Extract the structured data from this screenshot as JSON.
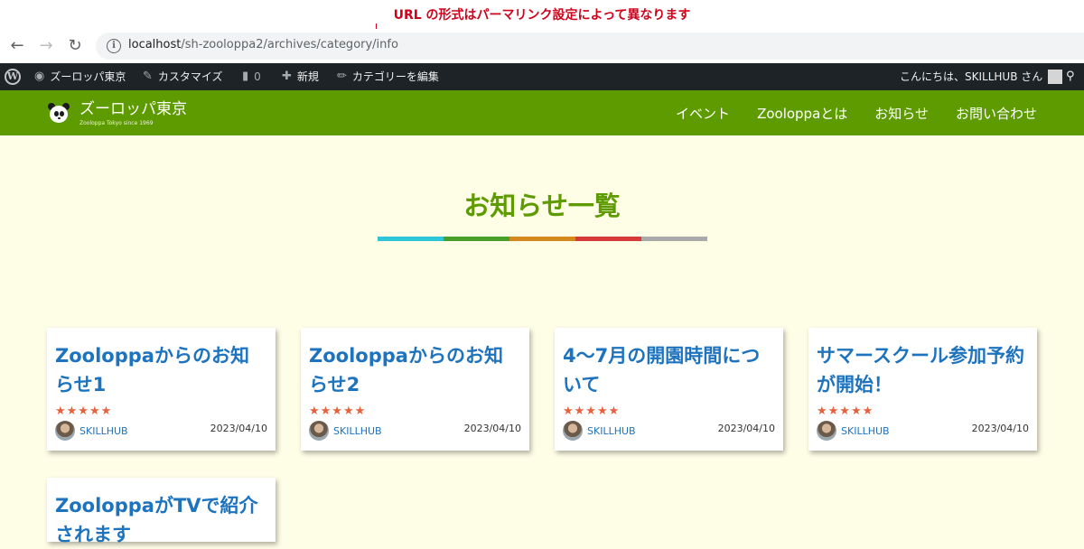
{
  "annotation": {
    "note": "URL の形式はパーマリンク設定によって異なります"
  },
  "browser": {
    "back_icon": "arrow-left-icon",
    "forward_icon": "arrow-right-icon",
    "reload_icon": "reload-icon",
    "url_host": "localhost",
    "url_path": "/sh-zooloppa2/archives/category/info"
  },
  "admin_bar": {
    "site_name": "ズーロッパ東京",
    "customize": "カスタマイズ",
    "comments_count": "0",
    "new": "新規",
    "edit_category": "カテゴリーを編集",
    "greeting": "こんにちは、SKILLHUB さん"
  },
  "header": {
    "site_title": "ズーロッパ東京",
    "tagline": "Zooloppa Tokyo since 1969",
    "nav": [
      "イベント",
      "Zooloppaとは",
      "お知らせ",
      "お問い合わせ"
    ]
  },
  "page": {
    "title": "お知らせ一覧",
    "bar_colors": [
      "#2ec5d8",
      "#4a9f2b",
      "#d4891e",
      "#d63a3a",
      "#a9a9a9"
    ]
  },
  "posts": [
    {
      "title": "Zooloppaからのお知らせ1",
      "stars": "★★★★★",
      "author": "SKILLHUB",
      "date": "2023/04/10"
    },
    {
      "title": "Zooloppaからのお知らせ2",
      "stars": "★★★★★",
      "author": "SKILLHUB",
      "date": "2023/04/10"
    },
    {
      "title": "4～7月の開園時間について",
      "stars": "★★★★★",
      "author": "SKILLHUB",
      "date": "2023/04/10"
    },
    {
      "title": "サマースクール参加予約が開始！",
      "stars": "★★★★★",
      "author": "SKILLHUB",
      "date": "2023/04/10"
    },
    {
      "title": "ZooloppaがTVで紹介されます"
    }
  ]
}
